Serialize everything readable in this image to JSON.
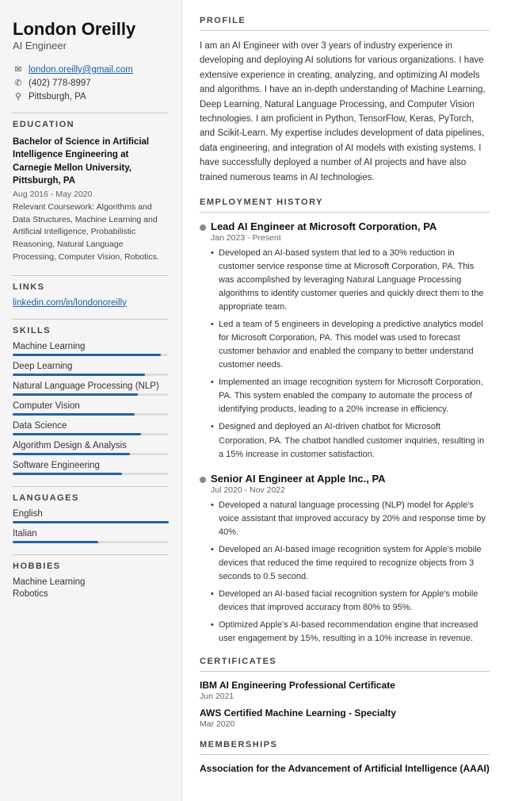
{
  "sidebar": {
    "name": "London Oreilly",
    "title": "AI Engineer",
    "contact": {
      "email": "london.oreilly@gmail.com",
      "phone": "(402) 778-8997",
      "location": "Pittsburgh, PA"
    },
    "education": {
      "degree": "Bachelor of Science in Artificial Intelligence Engineering at Carnegie Mellon University, Pittsburgh, PA",
      "dates": "Aug 2016 - May 2020",
      "courses": "Relevant Coursework: Algorithms and Data Structures, Machine Learning and Artificial Intelligence, Probabilistic Reasoning, Natural Language Processing, Computer Vision, Robotics."
    },
    "links": {
      "label": "LINKS",
      "url": "linkedin.com/in/londonoreilly"
    },
    "skills": {
      "label": "SKILLS",
      "items": [
        {
          "name": "Machine Learning",
          "pct": 95
        },
        {
          "name": "Deep Learning",
          "pct": 85
        },
        {
          "name": "Natural Language Processing (NLP)",
          "pct": 80
        },
        {
          "name": "Computer Vision",
          "pct": 78
        },
        {
          "name": "Data Science",
          "pct": 82
        },
        {
          "name": "Algorithm Design & Analysis",
          "pct": 75
        },
        {
          "name": "Software Engineering",
          "pct": 70
        }
      ]
    },
    "languages": {
      "label": "LANGUAGES",
      "items": [
        {
          "name": "English",
          "pct": 100
        },
        {
          "name": "Italian",
          "pct": 55
        }
      ]
    },
    "hobbies": {
      "label": "HOBBIES",
      "items": [
        "Machine Learning",
        "Robotics"
      ]
    }
  },
  "main": {
    "profile": {
      "label": "PROFILE",
      "text": "I am an AI Engineer with over 3 years of industry experience in developing and deploying AI solutions for various organizations. I have extensive experience in creating, analyzing, and optimizing AI models and algorithms. I have an in-depth understanding of Machine Learning, Deep Learning, Natural Language Processing, and Computer Vision technologies. I am proficient in Python, TensorFlow, Keras, PyTorch, and Scikit-Learn. My expertise includes development of data pipelines, data engineering, and integration of AI models with existing systems. I have successfully deployed a number of AI projects and have also trained numerous teams in AI technologies."
    },
    "employment": {
      "label": "EMPLOYMENT HISTORY",
      "jobs": [
        {
          "title": "Lead AI Engineer at Microsoft Corporation, PA",
          "dates": "Jan 2023 - Present",
          "bullets": [
            "Developed an AI-based system that led to a 30% reduction in customer service response time at Microsoft Corporation, PA. This was accomplished by leveraging Natural Language Processing algorithms to identify customer queries and quickly direct them to the appropriate team.",
            "Led a team of 5 engineers in developing a predictive analytics model for Microsoft Corporation, PA. This model was used to forecast customer behavior and enabled the company to better understand customer needs.",
            "Implemented an image recognition system for Microsoft Corporation, PA. This system enabled the company to automate the process of identifying products, leading to a 20% increase in efficiency.",
            "Designed and deployed an AI-driven chatbot for Microsoft Corporation, PA. The chatbot handled customer inquiries, resulting in a 15% increase in customer satisfaction."
          ]
        },
        {
          "title": "Senior AI Engineer at Apple Inc., PA",
          "dates": "Jul 2020 - Nov 2022",
          "bullets": [
            "Developed a natural language processing (NLP) model for Apple's voice assistant that improved accuracy by 20% and response time by 40%.",
            "Developed an AI-based image recognition system for Apple's mobile devices that reduced the time required to recognize objects from 3 seconds to 0.5 second.",
            "Developed an AI-based facial recognition system for Apple's mobile devices that improved accuracy from 80% to 95%.",
            "Optimized Apple's AI-based recommendation engine that increased user engagement by 15%, resulting in a 10% increase in revenue."
          ]
        }
      ]
    },
    "certificates": {
      "label": "CERTIFICATES",
      "items": [
        {
          "title": "IBM AI Engineering Professional Certificate",
          "date": "Jun 2021"
        },
        {
          "title": "AWS Certified Machine Learning - Specialty",
          "date": "Mar 2020"
        }
      ]
    },
    "memberships": {
      "label": "MEMBERSHIPS",
      "items": [
        {
          "title": "Association for the Advancement of Artificial Intelligence (AAAI)"
        }
      ]
    }
  }
}
